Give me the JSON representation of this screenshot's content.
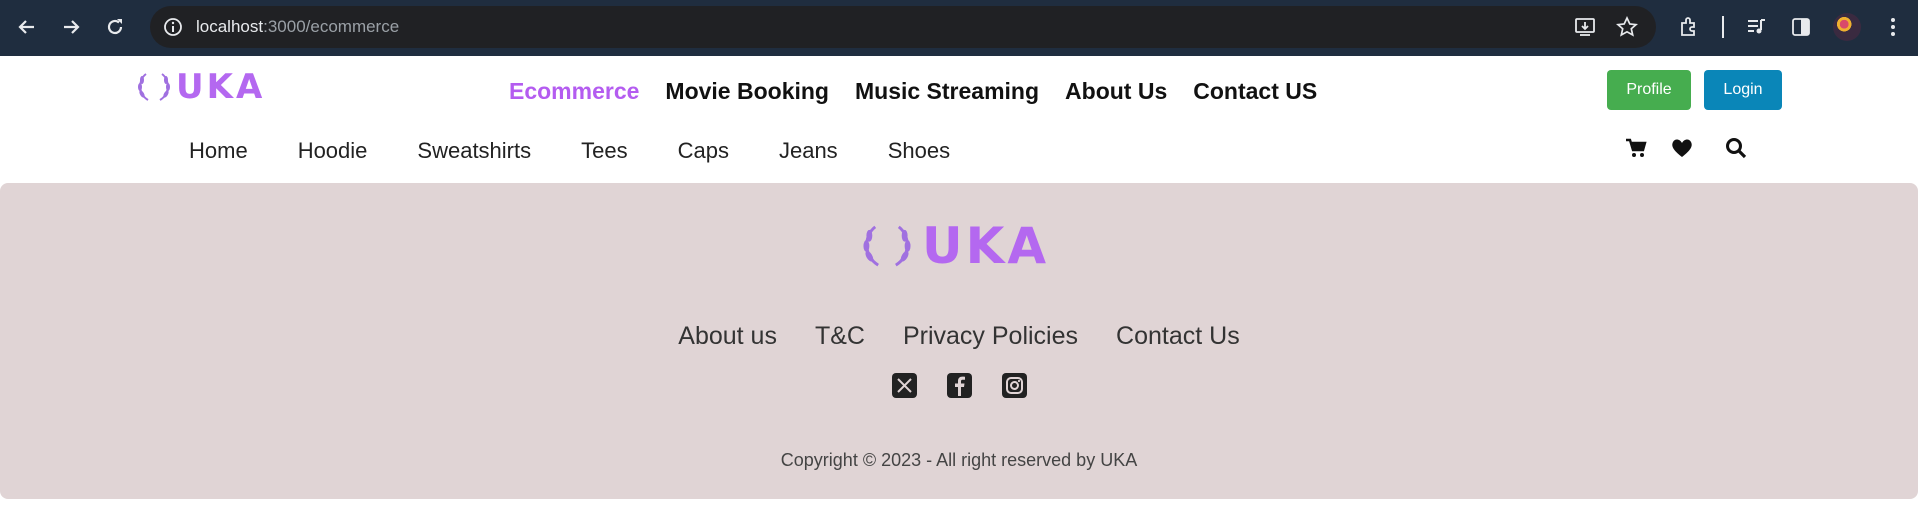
{
  "browser": {
    "url_host": "localhost",
    "url_path": ":3000/ecommerce"
  },
  "header": {
    "logo_text": "UKA",
    "main_nav": [
      {
        "label": "Ecommerce",
        "active": true
      },
      {
        "label": "Movie Booking",
        "active": false
      },
      {
        "label": "Music Streaming",
        "active": false
      },
      {
        "label": "About Us",
        "active": false
      },
      {
        "label": "Contact US",
        "active": false
      }
    ],
    "profile_label": "Profile",
    "login_label": "Login",
    "categories": [
      "Home",
      "Hoodie",
      "Sweatshirts",
      "Tees",
      "Caps",
      "Jeans",
      "Shoes"
    ],
    "icons": [
      "cart-icon",
      "heart-icon",
      "search-icon"
    ]
  },
  "footer": {
    "logo_text": "UKA",
    "links": [
      "About us",
      "T&C",
      "Privacy Policies",
      "Contact Us"
    ],
    "social": [
      "x-twitter-icon",
      "facebook-icon",
      "instagram-icon"
    ],
    "copyright": "Copyright © 2023 - All right reserved by UKA"
  },
  "colors": {
    "accent": "#b45cf0",
    "profile_button": "#46ad4f",
    "login_button": "#0a86b8",
    "footer_bg": "#e0d4d5",
    "chrome_bg": "#1f2d3f"
  }
}
